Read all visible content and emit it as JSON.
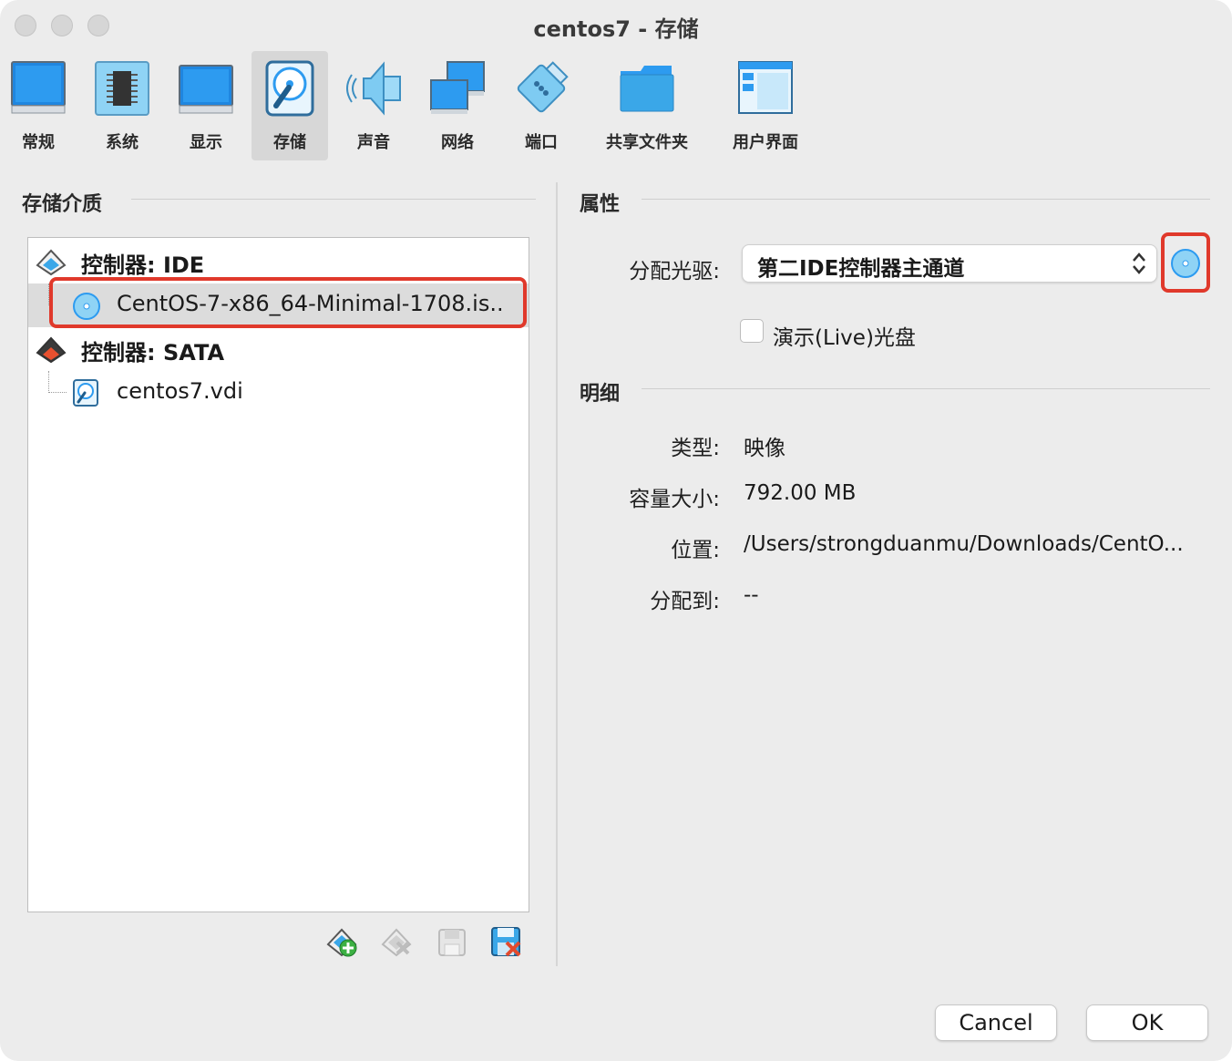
{
  "window": {
    "title": "centos7 - 存储"
  },
  "toolbar": {
    "items": [
      {
        "label": "常规",
        "icon": "monitor-general-icon"
      },
      {
        "label": "系统",
        "icon": "chip-icon"
      },
      {
        "label": "显示",
        "icon": "display-icon"
      },
      {
        "label": "存储",
        "icon": "storage-disk-icon",
        "active": true
      },
      {
        "label": "声音",
        "icon": "speaker-icon"
      },
      {
        "label": "网络",
        "icon": "network-icon"
      },
      {
        "label": "端口",
        "icon": "serial-port-icon"
      },
      {
        "label": "共享文件夹",
        "icon": "folder-icon"
      },
      {
        "label": "用户界面",
        "icon": "user-interface-icon"
      }
    ]
  },
  "storage": {
    "title": "存储介质",
    "tree": [
      {
        "label": "控制器: IDE",
        "icon": "ide-controller-icon"
      },
      {
        "label": "CentOS-7-x86_64-Minimal-1708.is..",
        "icon": "optical-disc-icon",
        "selected": true
      },
      {
        "label": "控制器: SATA",
        "icon": "sata-controller-icon"
      },
      {
        "label": "centos7.vdi",
        "icon": "hard-disk-icon"
      }
    ],
    "tools": [
      "add-attachment-icon",
      "remove-attachment-icon",
      "add-controller-icon",
      "remove-controller-icon"
    ]
  },
  "attributes": {
    "title": "属性",
    "drive_label": "分配光驱:",
    "drive_value": "第二IDE控制器主通道",
    "live_cd_label": "演示(Live)光盘",
    "live_cd_checked": false
  },
  "details": {
    "title": "明细",
    "type_label": "类型:",
    "type_value": "映像",
    "size_label": "容量大小:",
    "size_value": "792.00 MB",
    "location_label": "位置:",
    "location_value": "/Users/strongduanmu/Downloads/CentO...",
    "attached_label": "分配到:",
    "attached_value": "--"
  },
  "buttons": {
    "cancel": "Cancel",
    "ok": "OK"
  },
  "colors": {
    "highlight": "#e0392b",
    "accent": "#3aa7e8"
  }
}
